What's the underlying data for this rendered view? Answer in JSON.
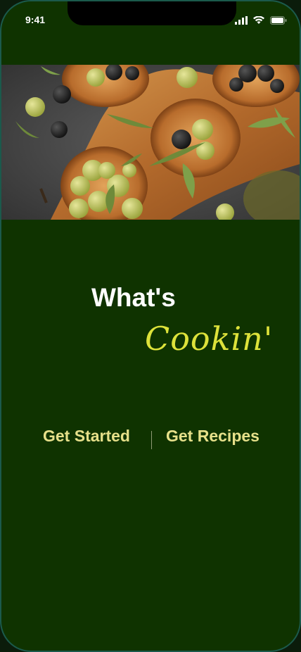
{
  "status_bar": {
    "time": "9:41",
    "icons": [
      "signal-icon",
      "wifi-icon",
      "battery-icon"
    ]
  },
  "hero_image": {
    "alt": "Olives in wooden bowls"
  },
  "title": {
    "line1": "What's",
    "line2": "Cookin'"
  },
  "nav": {
    "get_started": "Get Started",
    "get_recipes": "Get Recipes"
  },
  "colors": {
    "background": "#0f3300",
    "accent": "#dde23a",
    "link": "#e6e08a"
  }
}
